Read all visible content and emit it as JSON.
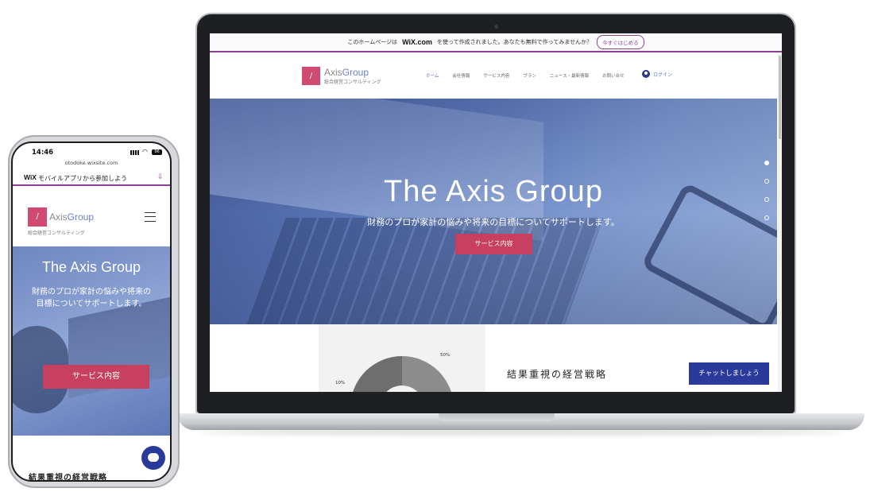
{
  "desktop": {
    "wix_banner": {
      "text_before": "このホームページは",
      "logo": "WiX.com",
      "text_after": "を使って作成されました。あなたも無料で作ってみませんか？",
      "button": "今すぐはじめる"
    },
    "header": {
      "logo_mark": "/",
      "logo_axis": "Axis",
      "logo_group": "Group",
      "logo_sub": "総合経営コンサルティング",
      "nav": [
        "ホーム",
        "会社情報",
        "サービス内容",
        "プラン",
        "ニュース・最新情報",
        "お問い合せ"
      ],
      "login": "ログイン"
    },
    "hero": {
      "title": "The Axis Group",
      "subtitle": "財務のプロが家計の悩みや将来の目標についてサポートします。",
      "button": "サービス内容"
    },
    "section": {
      "chart_label_50": "50%",
      "chart_label_10": "10%",
      "title": "結果重視の経営戦略",
      "chat_button": "チャットしましょう"
    }
  },
  "mobile": {
    "time": "14:46",
    "battery": "96",
    "url": "otodoke.wixsite.com",
    "wix_logo": "WiX",
    "wix_text": "モバイルアプリから参加しよう",
    "logo_mark": "/",
    "logo_axis": "Axis",
    "logo_group": "Group",
    "logo_sub": "総合経営コンサルティング",
    "hero_title": "The Axis Group",
    "hero_sub_line1": "財務のプロが家計の悩みや将来の",
    "hero_sub_line2": "目標についてサポートします。",
    "hero_button": "サービス内容",
    "section_title": "結果重視の経営戦略"
  },
  "colors": {
    "brand_pink": "#d14a72",
    "button_red": "#c7405f",
    "chat_blue": "#2a3a9a",
    "wix_purple": "#8e3f94",
    "logo_blue": "#6c7fc8"
  }
}
